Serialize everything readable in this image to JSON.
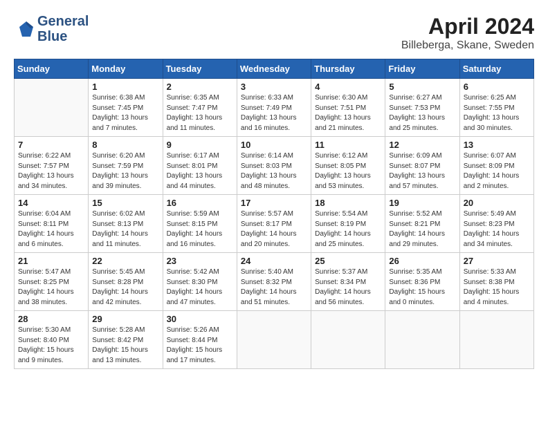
{
  "header": {
    "logo_line1": "General",
    "logo_line2": "Blue",
    "month": "April 2024",
    "location": "Billeberga, Skane, Sweden"
  },
  "days_of_week": [
    "Sunday",
    "Monday",
    "Tuesday",
    "Wednesday",
    "Thursday",
    "Friday",
    "Saturday"
  ],
  "weeks": [
    [
      {
        "day": "",
        "detail": ""
      },
      {
        "day": "1",
        "detail": "Sunrise: 6:38 AM\nSunset: 7:45 PM\nDaylight: 13 hours\nand 7 minutes."
      },
      {
        "day": "2",
        "detail": "Sunrise: 6:35 AM\nSunset: 7:47 PM\nDaylight: 13 hours\nand 11 minutes."
      },
      {
        "day": "3",
        "detail": "Sunrise: 6:33 AM\nSunset: 7:49 PM\nDaylight: 13 hours\nand 16 minutes."
      },
      {
        "day": "4",
        "detail": "Sunrise: 6:30 AM\nSunset: 7:51 PM\nDaylight: 13 hours\nand 21 minutes."
      },
      {
        "day": "5",
        "detail": "Sunrise: 6:27 AM\nSunset: 7:53 PM\nDaylight: 13 hours\nand 25 minutes."
      },
      {
        "day": "6",
        "detail": "Sunrise: 6:25 AM\nSunset: 7:55 PM\nDaylight: 13 hours\nand 30 minutes."
      }
    ],
    [
      {
        "day": "7",
        "detail": "Sunrise: 6:22 AM\nSunset: 7:57 PM\nDaylight: 13 hours\nand 34 minutes."
      },
      {
        "day": "8",
        "detail": "Sunrise: 6:20 AM\nSunset: 7:59 PM\nDaylight: 13 hours\nand 39 minutes."
      },
      {
        "day": "9",
        "detail": "Sunrise: 6:17 AM\nSunset: 8:01 PM\nDaylight: 13 hours\nand 44 minutes."
      },
      {
        "day": "10",
        "detail": "Sunrise: 6:14 AM\nSunset: 8:03 PM\nDaylight: 13 hours\nand 48 minutes."
      },
      {
        "day": "11",
        "detail": "Sunrise: 6:12 AM\nSunset: 8:05 PM\nDaylight: 13 hours\nand 53 minutes."
      },
      {
        "day": "12",
        "detail": "Sunrise: 6:09 AM\nSunset: 8:07 PM\nDaylight: 13 hours\nand 57 minutes."
      },
      {
        "day": "13",
        "detail": "Sunrise: 6:07 AM\nSunset: 8:09 PM\nDaylight: 14 hours\nand 2 minutes."
      }
    ],
    [
      {
        "day": "14",
        "detail": "Sunrise: 6:04 AM\nSunset: 8:11 PM\nDaylight: 14 hours\nand 6 minutes."
      },
      {
        "day": "15",
        "detail": "Sunrise: 6:02 AM\nSunset: 8:13 PM\nDaylight: 14 hours\nand 11 minutes."
      },
      {
        "day": "16",
        "detail": "Sunrise: 5:59 AM\nSunset: 8:15 PM\nDaylight: 14 hours\nand 16 minutes."
      },
      {
        "day": "17",
        "detail": "Sunrise: 5:57 AM\nSunset: 8:17 PM\nDaylight: 14 hours\nand 20 minutes."
      },
      {
        "day": "18",
        "detail": "Sunrise: 5:54 AM\nSunset: 8:19 PM\nDaylight: 14 hours\nand 25 minutes."
      },
      {
        "day": "19",
        "detail": "Sunrise: 5:52 AM\nSunset: 8:21 PM\nDaylight: 14 hours\nand 29 minutes."
      },
      {
        "day": "20",
        "detail": "Sunrise: 5:49 AM\nSunset: 8:23 PM\nDaylight: 14 hours\nand 34 minutes."
      }
    ],
    [
      {
        "day": "21",
        "detail": "Sunrise: 5:47 AM\nSunset: 8:25 PM\nDaylight: 14 hours\nand 38 minutes."
      },
      {
        "day": "22",
        "detail": "Sunrise: 5:45 AM\nSunset: 8:28 PM\nDaylight: 14 hours\nand 42 minutes."
      },
      {
        "day": "23",
        "detail": "Sunrise: 5:42 AM\nSunset: 8:30 PM\nDaylight: 14 hours\nand 47 minutes."
      },
      {
        "day": "24",
        "detail": "Sunrise: 5:40 AM\nSunset: 8:32 PM\nDaylight: 14 hours\nand 51 minutes."
      },
      {
        "day": "25",
        "detail": "Sunrise: 5:37 AM\nSunset: 8:34 PM\nDaylight: 14 hours\nand 56 minutes."
      },
      {
        "day": "26",
        "detail": "Sunrise: 5:35 AM\nSunset: 8:36 PM\nDaylight: 15 hours\nand 0 minutes."
      },
      {
        "day": "27",
        "detail": "Sunrise: 5:33 AM\nSunset: 8:38 PM\nDaylight: 15 hours\nand 4 minutes."
      }
    ],
    [
      {
        "day": "28",
        "detail": "Sunrise: 5:30 AM\nSunset: 8:40 PM\nDaylight: 15 hours\nand 9 minutes."
      },
      {
        "day": "29",
        "detail": "Sunrise: 5:28 AM\nSunset: 8:42 PM\nDaylight: 15 hours\nand 13 minutes."
      },
      {
        "day": "30",
        "detail": "Sunrise: 5:26 AM\nSunset: 8:44 PM\nDaylight: 15 hours\nand 17 minutes."
      },
      {
        "day": "",
        "detail": ""
      },
      {
        "day": "",
        "detail": ""
      },
      {
        "day": "",
        "detail": ""
      },
      {
        "day": "",
        "detail": ""
      }
    ]
  ]
}
